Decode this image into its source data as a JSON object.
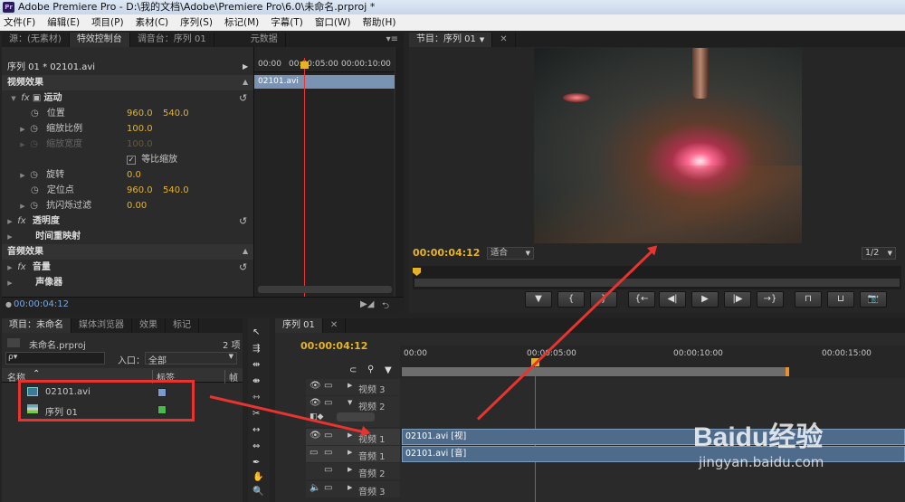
{
  "window": {
    "title": "Adobe Premiere Pro - D:\\我的文档\\Adobe\\Premiere Pro\\6.0\\未命名.prproj *",
    "app_icon": "Pr"
  },
  "menu": [
    "文件(F)",
    "编辑(E)",
    "项目(P)",
    "素材(C)",
    "序列(S)",
    "标记(M)",
    "字幕(T)",
    "窗口(W)",
    "帮助(H)"
  ],
  "effect_panel": {
    "tabs": [
      "源：(无素材)",
      "特效控制台",
      "调音台：序列 01",
      "元数据"
    ],
    "sequence_label": "序列 01 * 02101.avi",
    "ruler": [
      "00:00",
      "00:00:05:00",
      "00:00:10:00"
    ],
    "clip_name": "02101.avi",
    "video_effects": "视频效果",
    "motion": "运动",
    "position": {
      "label": "位置",
      "x": "960.0",
      "y": "540.0"
    },
    "scale": {
      "label": "缩放比例",
      "value": "100.0"
    },
    "scale_width": {
      "label": "缩放宽度",
      "value": "100.0"
    },
    "uniform": "等比缩放",
    "rotation": {
      "label": "旋转",
      "value": "0.0"
    },
    "anchor": {
      "label": "定位点",
      "x": "960.0",
      "y": "540.0"
    },
    "flicker": {
      "label": "抗闪烁过滤",
      "value": "0.00"
    },
    "opacity": "透明度",
    "time_remap": "时间重映射",
    "audio_effects": "音频效果",
    "volume": "音量",
    "panner": "声像器",
    "timecode": "00:00:04:12"
  },
  "program": {
    "tab": "节目：序列 01",
    "timecode": "00:00:04:12",
    "fit": "适合",
    "quality": "1/2"
  },
  "project": {
    "tabs": [
      "项目：未命名",
      "媒体浏览器",
      "效果",
      "标记"
    ],
    "file": "未命名.prproj",
    "count": "2 项",
    "search_placeholder": "ρ▾",
    "inlet_label": "入口：",
    "inlet_value": "全部",
    "col_name": "名称",
    "col_label": "标签",
    "col_frame": "帧",
    "items": [
      {
        "name": "02101.avi",
        "color": "#7a9ad0"
      },
      {
        "name": "序列 01",
        "color": "#4bb84b"
      }
    ]
  },
  "timeline": {
    "tab": "序列 01",
    "timecode": "00:00:04:12",
    "ruler": [
      "00:00",
      "00:00:05:00",
      "00:00:10:00",
      "00:00:15:00"
    ],
    "tracks": [
      "视频 3",
      "视频 2",
      "视频 1",
      "音频 1",
      "音频 2",
      "音频 3"
    ],
    "video_clip": "02101.avi [视]",
    "audio_clip": "02101.avi [音]"
  },
  "watermark": {
    "brand": "Baidu经验",
    "url": "jingyan.baidu.com"
  }
}
